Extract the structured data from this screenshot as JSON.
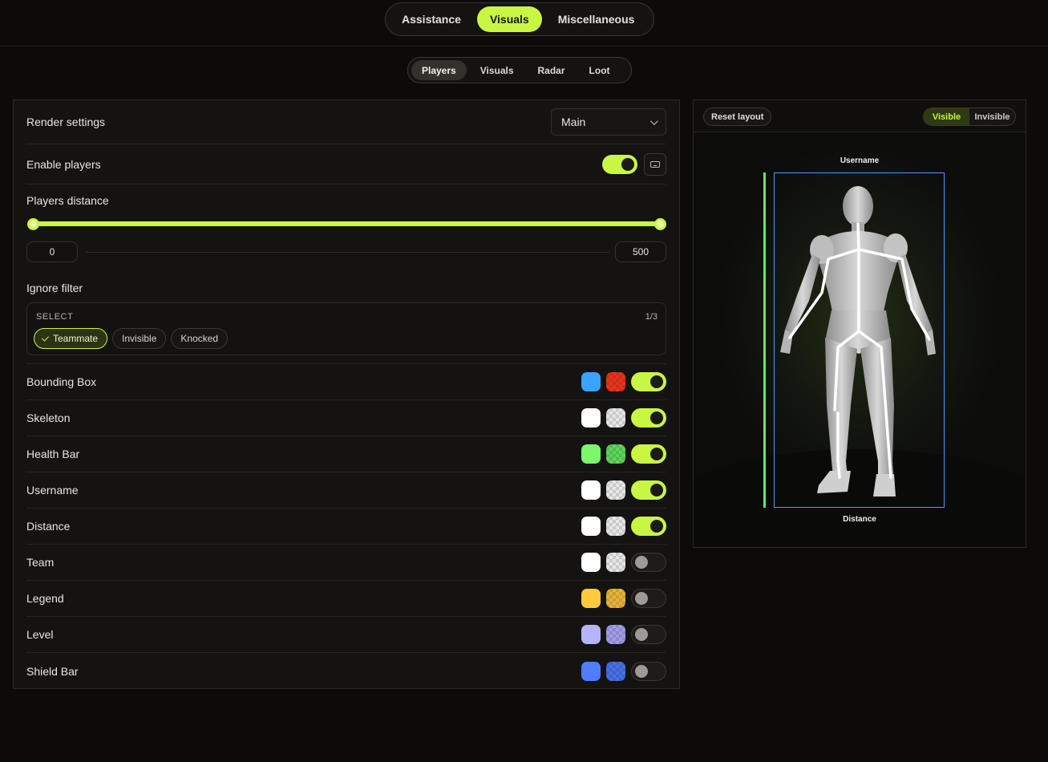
{
  "nav": {
    "main_tabs": [
      "Assistance",
      "Visuals",
      "Miscellaneous"
    ],
    "active_main": "Visuals",
    "sub_tabs": [
      "Players",
      "Visuals",
      "Radar",
      "Loot"
    ],
    "active_sub": "Players"
  },
  "settings": {
    "render_label": "Render settings",
    "render_value": "Main",
    "enable_label": "Enable players",
    "enable_on": true,
    "distance_label": "Players distance",
    "distance_min": "0",
    "distance_max": "500",
    "ignore_label": "Ignore filter",
    "select_title": "SELECT",
    "select_count": "1/3",
    "filters": [
      {
        "label": "Teammate",
        "selected": true
      },
      {
        "label": "Invisible",
        "selected": false
      },
      {
        "label": "Knocked",
        "selected": false
      }
    ]
  },
  "features": [
    {
      "label": "Bounding Box",
      "color": "#3aa3ff",
      "color2": "#e8341c",
      "on": true
    },
    {
      "label": "Skeleton",
      "color": "#ffffff",
      "color2": "#e6e6e6",
      "on": true
    },
    {
      "label": "Health Bar",
      "color": "#7cf76a",
      "color2": "#5fd45a",
      "on": true
    },
    {
      "label": "Username",
      "color": "#ffffff",
      "color2": "#e6e6e6",
      "on": true
    },
    {
      "label": "Distance",
      "color": "#ffffff",
      "color2": "#e6e6e6",
      "on": true
    },
    {
      "label": "Team",
      "color": "#ffffff",
      "color2": "#e6e6e6",
      "on": false
    },
    {
      "label": "Legend",
      "color": "#ffcb3d",
      "color2": "#e6b33a",
      "on": false
    },
    {
      "label": "Level",
      "color": "#b7b4ff",
      "color2": "#a09de8",
      "on": false
    },
    {
      "label": "Shield Bar",
      "color": "#4e7dff",
      "color2": "#4670e6",
      "on": false
    }
  ],
  "preview": {
    "reset_label": "Reset layout",
    "visible_label": "Visible",
    "invisible_label": "Invisible",
    "esp_username": "Username",
    "esp_distance": "Distance"
  },
  "colors": {
    "accent": "#c9f543",
    "box": "#4a9bff",
    "health": "#62e86a"
  }
}
